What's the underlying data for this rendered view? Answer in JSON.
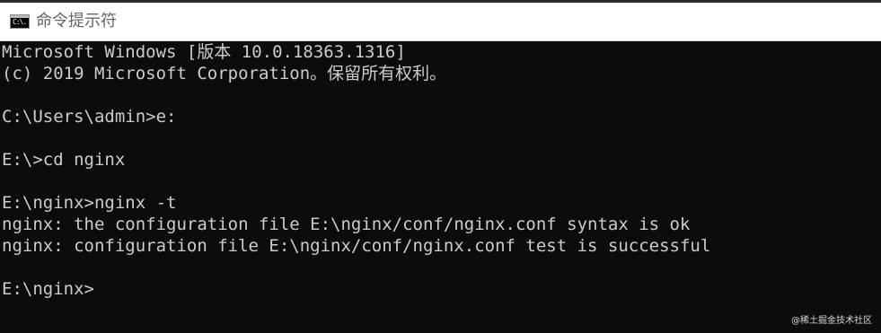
{
  "window": {
    "title": "命令提示符",
    "icon_text": "C:\\."
  },
  "console": {
    "lines": [
      "Microsoft Windows [版本 10.0.18363.1316]",
      "(c) 2019 Microsoft Corporation。保留所有权利。",
      "",
      "C:\\Users\\admin>e:",
      "",
      "E:\\>cd nginx",
      "",
      "E:\\nginx>nginx -t",
      "nginx: the configuration file E:\\nginx/conf/nginx.conf syntax is ok",
      "nginx: configuration file E:\\nginx/conf/nginx.conf test is successful",
      "",
      "E:\\nginx>"
    ]
  },
  "watermark": "@稀土掘金技术社区",
  "colors": {
    "console_background": "#0c0c0c",
    "console_text": "#cccccc",
    "titlebar_background": "#ffffff",
    "title_text": "#666666"
  }
}
